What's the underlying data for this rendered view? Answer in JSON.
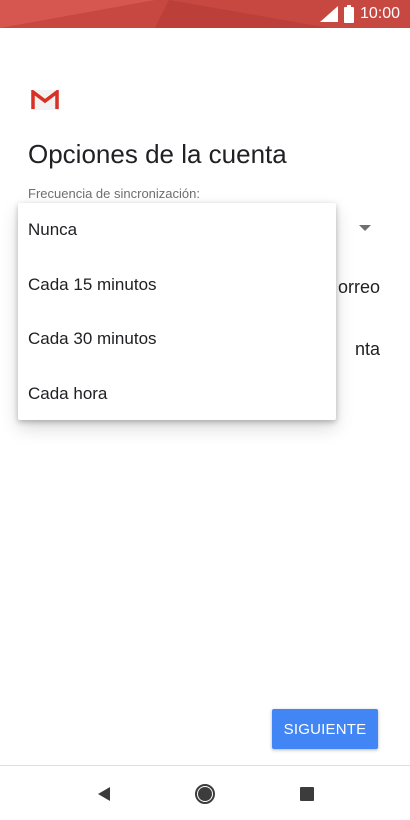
{
  "status_bar": {
    "time": "10:00",
    "icons": [
      "signal-icon",
      "battery-icon"
    ],
    "color": "#c74741"
  },
  "header": {
    "logo": "gmail-logo",
    "title": "Opciones de la cuenta"
  },
  "sync": {
    "label": "Frecuencia de sincronización:",
    "options": [
      "Nunca",
      "Cada 15 minutos",
      "Cada 30 minutos",
      "Cada hora"
    ]
  },
  "background_text": {
    "line1": "orreo",
    "line2": "nta"
  },
  "next_button": {
    "label": "SIGUIENTE",
    "color": "#4285f4"
  },
  "nav_bar": {
    "icons": [
      "back-icon",
      "home-icon",
      "recents-icon"
    ]
  }
}
